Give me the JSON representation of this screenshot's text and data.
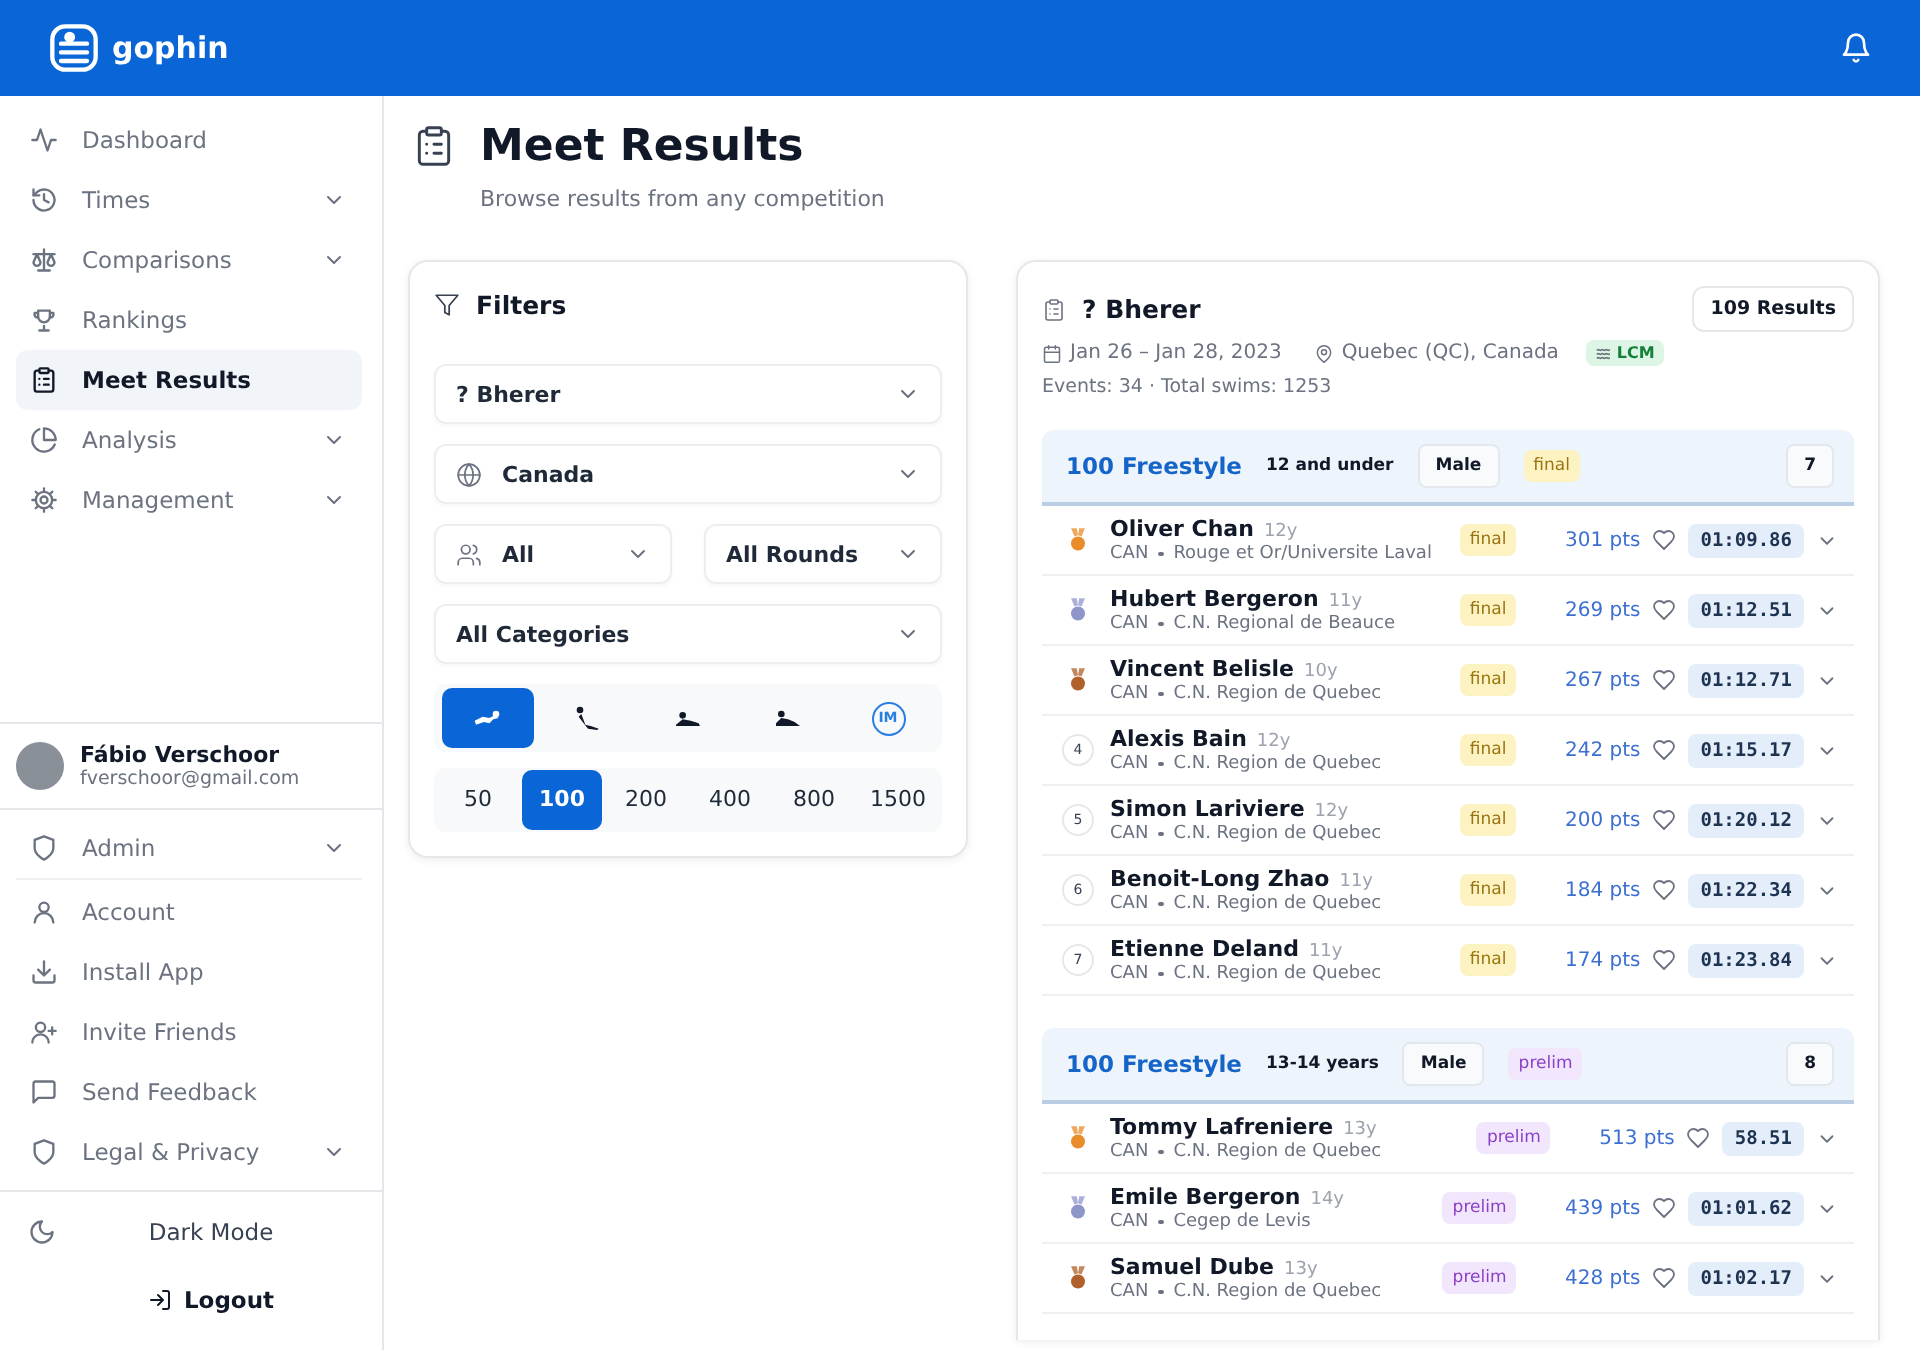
{
  "app": {
    "name": "gophin"
  },
  "sidebar": {
    "nav": [
      {
        "label": "Dashboard",
        "submenu": false,
        "selected": false
      },
      {
        "label": "Times",
        "submenu": true,
        "selected": false
      },
      {
        "label": "Comparisons",
        "submenu": true,
        "selected": false
      },
      {
        "label": "Rankings",
        "submenu": false,
        "selected": false
      },
      {
        "label": "Meet Results",
        "submenu": false,
        "selected": true
      },
      {
        "label": "Analysis",
        "submenu": true,
        "selected": false
      },
      {
        "label": "Management",
        "submenu": true,
        "selected": false
      }
    ],
    "user": {
      "name": "Fábio Verschoor",
      "email": "fverschoor@gmail.com"
    },
    "account_menu": [
      {
        "label": "Admin",
        "submenu": true
      },
      {
        "label": "Account",
        "submenu": false
      },
      {
        "label": "Install App",
        "submenu": false
      },
      {
        "label": "Invite Friends",
        "submenu": false
      },
      {
        "label": "Send Feedback",
        "submenu": false
      },
      {
        "label": "Legal & Privacy",
        "submenu": true
      }
    ],
    "dark_mode": "Dark Mode",
    "logout": "Logout"
  },
  "page": {
    "title": "Meet Results",
    "subtitle": "Browse results from any competition"
  },
  "filters": {
    "title": "Filters",
    "meet": "? Bherer",
    "country": "Canada",
    "gender": "All",
    "round": "All Rounds",
    "category": "All Categories",
    "strokes": [
      {
        "kind": "freestyle",
        "selected": true
      },
      {
        "kind": "butterfly",
        "selected": false
      },
      {
        "kind": "backstroke",
        "selected": false
      },
      {
        "kind": "breaststroke",
        "selected": false
      },
      {
        "kind": "medley",
        "label": "IM",
        "selected": false
      }
    ],
    "distances": [
      {
        "label": "50",
        "selected": false
      },
      {
        "label": "100",
        "selected": true
      },
      {
        "label": "200",
        "selected": false
      },
      {
        "label": "400",
        "selected": false
      },
      {
        "label": "800",
        "selected": false
      },
      {
        "label": "1500",
        "selected": false
      }
    ]
  },
  "meet": {
    "name": "? Bherer",
    "results": "109 Results",
    "dates": "Jan 26 – Jan 28, 2023",
    "location": "Quebec (QC), Canada",
    "course": "LCM",
    "stats": "Events: 34 · Total swims: 1253"
  },
  "events": [
    {
      "title": "100 Freestyle",
      "age_group": "12 and under",
      "gender": "Male",
      "round": {
        "text": "final",
        "kind": "final"
      },
      "count": "7",
      "results": [
        {
          "kind": "gold",
          "name": "Oliver Chan",
          "age": "12y",
          "country": "CAN",
          "club": "Rouge et Or/Universite Laval",
          "round": {
            "text": "final",
            "kind": "final"
          },
          "points": "301 pts",
          "favorite": false,
          "time": "01:09.86"
        },
        {
          "kind": "silver",
          "name": "Hubert Bergeron",
          "age": "11y",
          "country": "CAN",
          "club": "C.N. Regional de Beauce",
          "round": {
            "text": "final",
            "kind": "final"
          },
          "points": "269 pts",
          "favorite": false,
          "time": "01:12.51"
        },
        {
          "kind": "bronze",
          "name": "Vincent Belisle",
          "age": "10y",
          "country": "CAN",
          "club": "C.N. Region de Quebec",
          "round": {
            "text": "final",
            "kind": "final"
          },
          "points": "267 pts",
          "favorite": false,
          "time": "01:12.71"
        },
        {
          "kind": "place",
          "place": "4",
          "name": "Alexis Bain",
          "age": "12y",
          "country": "CAN",
          "club": "C.N. Region de Quebec",
          "round": {
            "text": "final",
            "kind": "final"
          },
          "points": "242 pts",
          "favorite": false,
          "time": "01:15.17"
        },
        {
          "kind": "place",
          "place": "5",
          "name": "Simon Lariviere",
          "age": "12y",
          "country": "CAN",
          "club": "C.N. Region de Quebec",
          "round": {
            "text": "final",
            "kind": "final"
          },
          "points": "200 pts",
          "favorite": false,
          "time": "01:20.12"
        },
        {
          "kind": "place",
          "place": "6",
          "name": "Benoit-Long Zhao",
          "age": "11y",
          "country": "CAN",
          "club": "C.N. Region de Quebec",
          "round": {
            "text": "final",
            "kind": "final"
          },
          "points": "184 pts",
          "favorite": false,
          "time": "01:22.34"
        },
        {
          "kind": "place",
          "place": "7",
          "name": "Etienne Deland",
          "age": "11y",
          "country": "CAN",
          "club": "C.N. Region de Quebec",
          "round": {
            "text": "final",
            "kind": "final"
          },
          "points": "174 pts",
          "favorite": false,
          "time": "01:23.84"
        }
      ]
    },
    {
      "title": "100 Freestyle",
      "age_group": "13-14 years",
      "gender": "Male",
      "round": {
        "text": "prelim",
        "kind": "prelim"
      },
      "count": "8",
      "results": [
        {
          "kind": "gold",
          "name": "Tommy Lafreniere",
          "age": "13y",
          "country": "CAN",
          "club": "C.N. Region de Quebec",
          "round": {
            "text": "prelim",
            "kind": "prelim"
          },
          "points": "513 pts",
          "favorite": false,
          "time": "58.51"
        },
        {
          "kind": "silver",
          "name": "Emile Bergeron",
          "age": "14y",
          "country": "CAN",
          "club": "Cegep de Levis",
          "round": {
            "text": "prelim",
            "kind": "prelim"
          },
          "points": "439 pts",
          "favorite": false,
          "time": "01:01.62"
        },
        {
          "kind": "bronze",
          "name": "Samuel Dube",
          "age": "13y",
          "country": "CAN",
          "club": "C.N. Region de Quebec",
          "round": {
            "text": "prelim",
            "kind": "prelim"
          },
          "points": "428 pts",
          "favorite": false,
          "time": "01:02.17"
        }
      ]
    }
  ]
}
